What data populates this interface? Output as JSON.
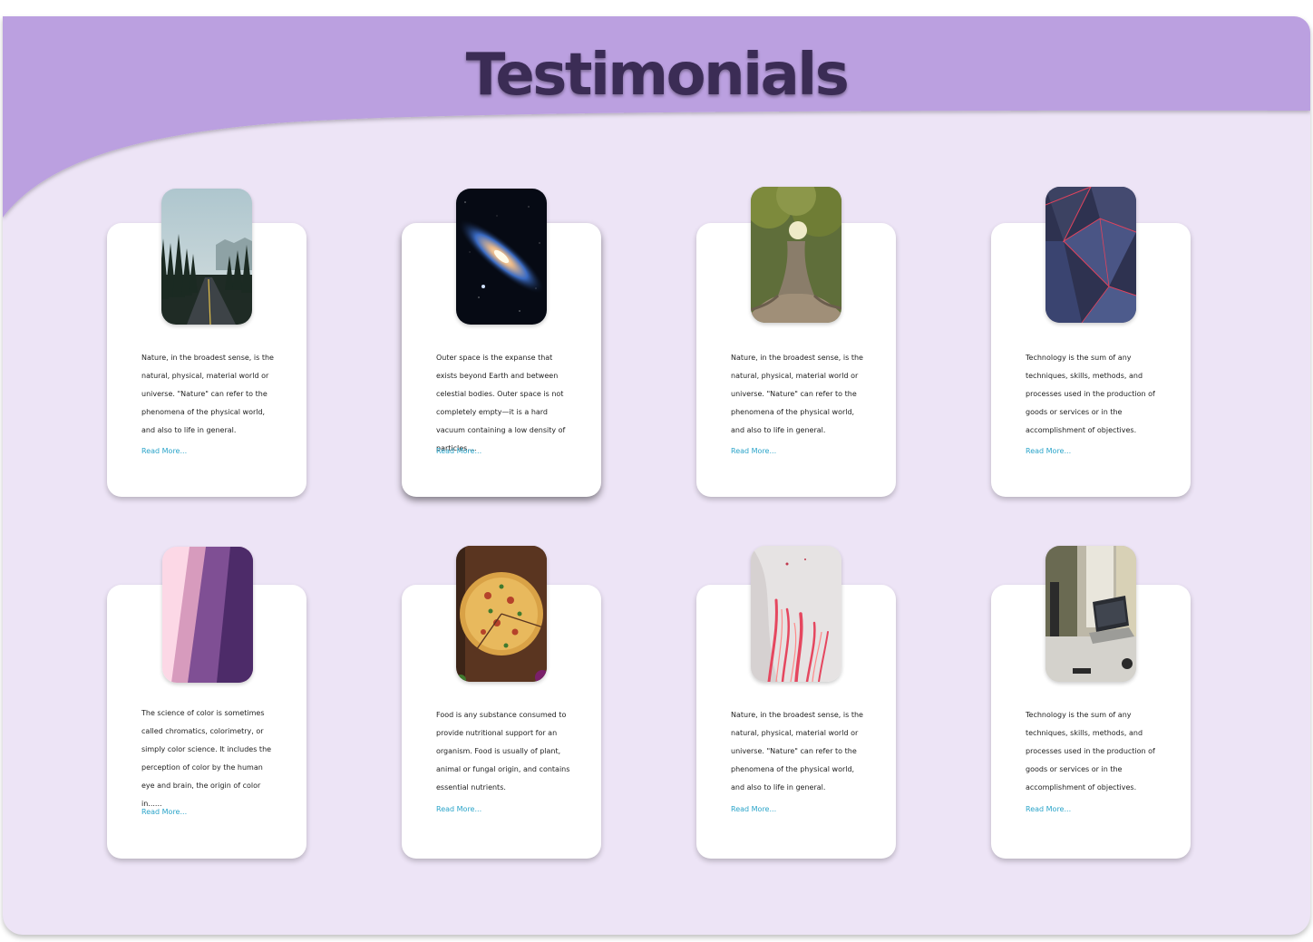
{
  "page": {
    "title": "Testimonials",
    "colors": {
      "header": "#bba0e0",
      "background": "#ede4f6",
      "title": "#3b2c55",
      "link": "#2aa4c9"
    }
  },
  "cards": [
    {
      "image": "forest-road-image",
      "text": "Nature, in the broadest sense, is the natural, physical, material world or universe. \"Nature\" can refer to the phenomena of the physical world, and also to life in general.",
      "link": "Read More..."
    },
    {
      "image": "galaxy-image",
      "text": "Outer space is the expanse that exists beyond Earth and between celestial bodies. Outer space is not completely empty—it is a hard vacuum containing a low density of particles,...",
      "link": "Read More..."
    },
    {
      "image": "tree-roots-image",
      "text": "Nature, in the broadest sense, is the natural, physical, material world or universe. \"Nature\" can refer to the phenomena of the physical world, and also to life in general.",
      "link": "Read More..."
    },
    {
      "image": "geometric-shapes-image",
      "text": "Technology is the sum of any techniques, skills, methods, and processes used in the production of goods or services or in the accomplishment of objectives.",
      "link": "Read More..."
    },
    {
      "image": "color-stripes-image",
      "text": "The science of color is sometimes called chromatics, colorimetry, or simply color science. It includes the perception of color by the human eye and brain, the origin of color in......",
      "link": "Read More..."
    },
    {
      "image": "pizza-image",
      "text": "Food is any substance consumed to provide nutritional support for an organism. Food is usually of plant, animal or fungal origin, and contains essential nutrients.",
      "link": "Read More..."
    },
    {
      "image": "pink-abstract-image",
      "text": "Nature, in the broadest sense, is the natural, physical, material world or universe. \"Nature\" can refer to the phenomena of the physical world, and also to life in general.",
      "link": "Read More..."
    },
    {
      "image": "laptop-desk-image",
      "text": "Technology is the sum of any techniques, skills, methods, and processes used in the production of goods or services or in the accomplishment of objectives.",
      "link": "Read More..."
    }
  ]
}
